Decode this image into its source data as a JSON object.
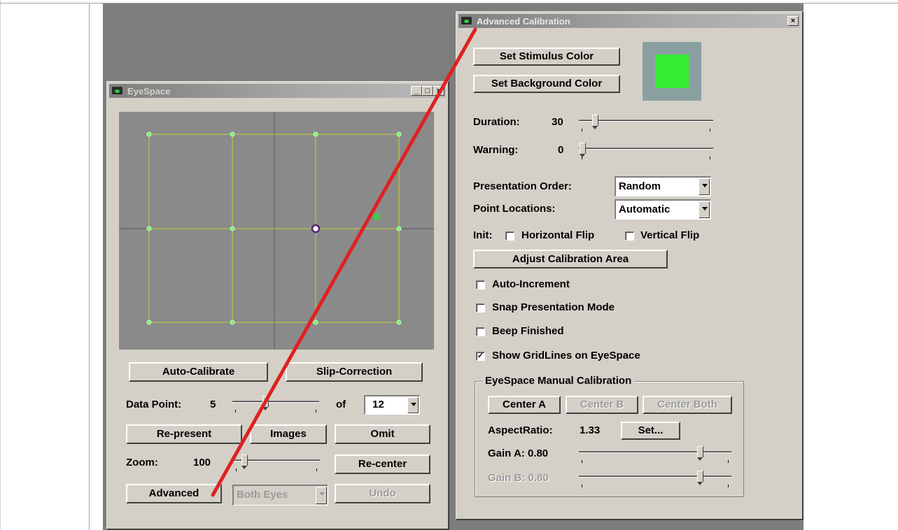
{
  "colors": {
    "stimulus": "#33ee33",
    "stimulus_background": "#8aa0a0",
    "grid_line": "#cccc33",
    "grid_point": "#66ff66",
    "eye_marker": "#552277",
    "red_line": "#e02020"
  },
  "eyespace_window": {
    "title": "EyeSpace",
    "icon": "eye-monitor-icon",
    "window_controls": {
      "minimize": "_",
      "maximize": "□",
      "close": "×"
    },
    "buttons": {
      "auto_calibrate": "Auto-Calibrate",
      "slip_correction": "Slip-Correction",
      "re_present": "Re-present",
      "images": "Images",
      "omit": "Omit",
      "re_center": "Re-center",
      "advanced": "Advanced",
      "undo": "Undo"
    },
    "data_point": {
      "label": "Data Point:",
      "value": "5",
      "of_label": "of",
      "total": "12",
      "slider_fraction": 0.38
    },
    "zoom": {
      "label": "Zoom:",
      "value": "100",
      "slider_fraction": 0.1
    },
    "eye_select": {
      "value": "Both Eyes"
    }
  },
  "advanced_window": {
    "title": "Advanced Calibration",
    "icon": "eye-monitor-icon",
    "close": "×",
    "buttons": {
      "stimulus_color": "Set Stimulus Color",
      "background_color": "Set Background Color",
      "adjust_area": "Adjust Calibration Area"
    },
    "duration": {
      "label": "Duration:",
      "value": "30",
      "slider_fraction": 0.1
    },
    "warning": {
      "label": "Warning:",
      "value": "0",
      "slider_fraction": 0.0
    },
    "presentation_order": {
      "label": "Presentation Order:",
      "value": "Random"
    },
    "point_locations": {
      "label": "Point Locations:",
      "value": "Automatic"
    },
    "init": {
      "label": "Init:",
      "horizontal_flip": "Horizontal Flip",
      "vertical_flip": "Vertical Flip"
    },
    "options": {
      "auto_increment": {
        "label": "Auto-Increment",
        "checked": false
      },
      "snap_presentation": {
        "label": "Snap Presentation Mode",
        "checked": false
      },
      "beep_finished": {
        "label": "Beep Finished",
        "checked": false
      },
      "show_gridlines": {
        "label": "Show GridLines on EyeSpace",
        "checked": true
      }
    },
    "manual_calibration": {
      "legend": "EyeSpace Manual Calibration",
      "center_a": "Center A",
      "center_b": "Center B",
      "center_both": "Center Both",
      "aspect_label": "AspectRatio:",
      "aspect_value": "1.33",
      "set_button": "Set...",
      "gain_a": {
        "label": "Gain A:",
        "value": "0.80",
        "slider_fraction": 0.8
      },
      "gain_b": {
        "label": "Gain B:",
        "value": "0.80",
        "slider_fraction": 0.8
      }
    },
    "check_mark": "✓"
  }
}
